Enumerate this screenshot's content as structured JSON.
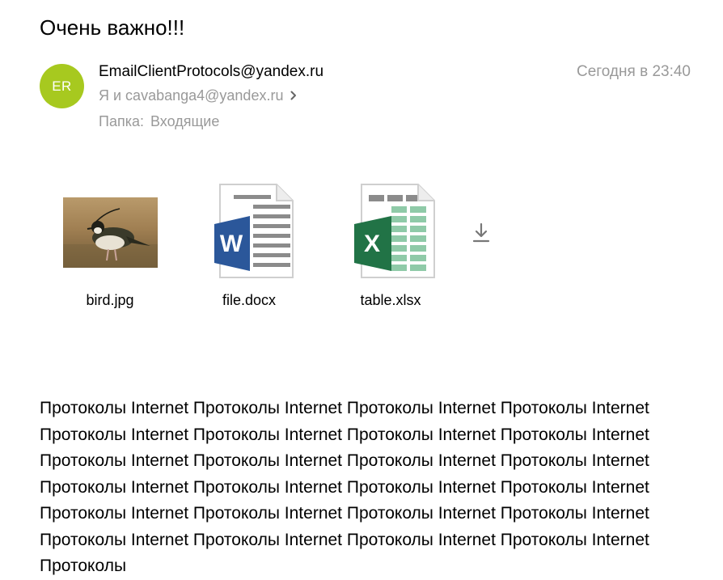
{
  "message": {
    "subject": "Очень важно!!!",
    "sender": {
      "initials": "ER",
      "email": "EmailClientProtocols@yandex.ru",
      "avatar_color": "#a7c91f"
    },
    "recipients_text": "Я и cavabanga4@yandex.ru",
    "folder_label": "Папка:",
    "folder_name": "Входящие",
    "date": "Сегодня в 23:40",
    "attachments": [
      {
        "filename": "bird.jpg",
        "icon": "photo-thumbnail"
      },
      {
        "filename": "file.docx",
        "icon": "word-doc-icon"
      },
      {
        "filename": "table.xlsx",
        "icon": "excel-sheet-icon"
      }
    ],
    "download_icon": "download-icon",
    "body": "Протоколы Internet Протоколы Internet Протоколы Internet Протоколы Internet Протоколы Internet Протоколы Internet Протоколы Internet Протоколы Internet Протоколы Internet Протоколы Internet Протоколы Internet Протоколы Internet Протоколы Internet Протоколы Internet Протоколы Internet Протоколы Internet Протоколы Internet Протоколы Internet Протоколы Internet Протоколы Internet Протоколы Internet Протоколы Internet Протоколы Internet Протоколы Internet Протоколы"
  },
  "colors": {
    "meta_gray": "#999999",
    "word_blue": "#2b579a",
    "excel_green": "#217346"
  }
}
